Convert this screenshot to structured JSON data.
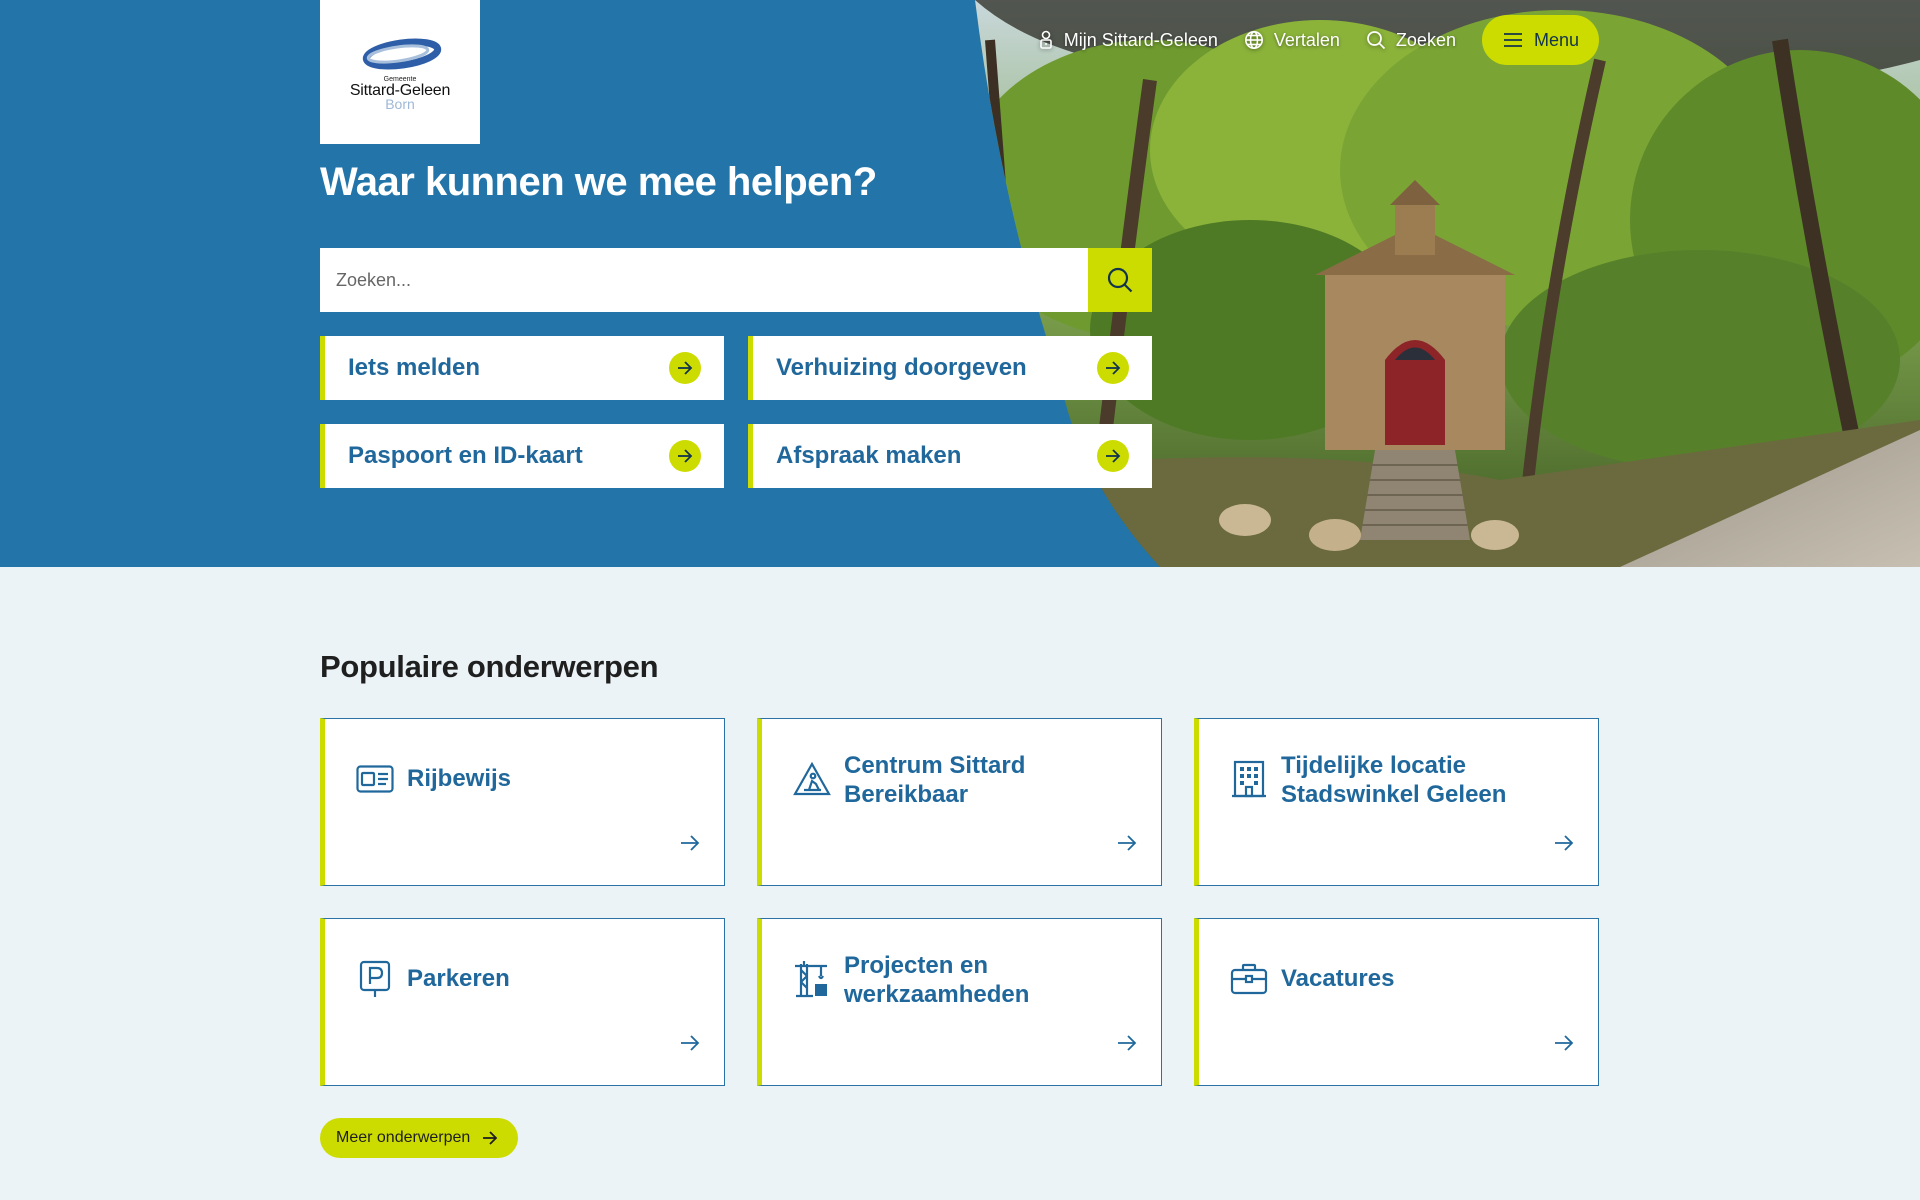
{
  "header": {
    "logo": {
      "small": "Gemeente",
      "name": "Sittard-Geleen",
      "sub": "Born"
    },
    "nav": [
      {
        "label": "Mijn Sittard-Geleen",
        "icon": "user-lock-icon"
      },
      {
        "label": "Vertalen",
        "icon": "globe-icon"
      },
      {
        "label": "Zoeken",
        "icon": "search-icon"
      }
    ],
    "menu_label": "Menu"
  },
  "hero": {
    "title": "Waar kunnen we mee helpen?",
    "search_placeholder": "Zoeken...",
    "quick_links": [
      {
        "label": "Iets melden"
      },
      {
        "label": "Verhuizing doorgeven"
      },
      {
        "label": "Paspoort en ID-kaart"
      },
      {
        "label": "Afspraak maken"
      }
    ]
  },
  "popular": {
    "title": "Populaire onderwerpen",
    "cards": [
      {
        "label": "Rijbewijs",
        "icon": "id-card-icon"
      },
      {
        "label": "Centrum Sittard Bereikbaar",
        "icon": "road-work-icon"
      },
      {
        "label": "Tijdelijke locatie Stadswinkel Geleen",
        "icon": "building-icon"
      },
      {
        "label": "Parkeren",
        "icon": "parking-icon"
      },
      {
        "label": "Projecten en werkzaamheden",
        "icon": "crane-icon"
      },
      {
        "label": "Vacatures",
        "icon": "briefcase-icon"
      }
    ],
    "more_label": "Meer onderwerpen"
  },
  "colors": {
    "primary_blue": "#2374a8",
    "accent_lime": "#cddc00",
    "link_blue": "#20689c",
    "page_bg": "#ebf3f6"
  }
}
